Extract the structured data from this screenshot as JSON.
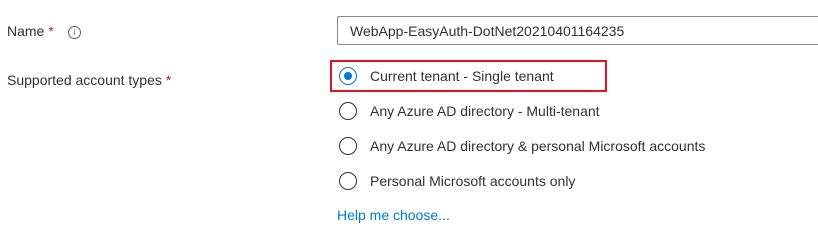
{
  "name_field": {
    "label": "Name",
    "required_marker": "*",
    "info_icon": "info-icon",
    "info_glyph": "i",
    "value": "WebApp-EasyAuth-DotNet20210401164235"
  },
  "account_types": {
    "label": "Supported account types",
    "required_marker": "*",
    "options": [
      {
        "label": "Current tenant - Single tenant",
        "selected": true
      },
      {
        "label": "Any Azure AD directory - Multi-tenant",
        "selected": false
      },
      {
        "label": "Any Azure AD directory & personal Microsoft accounts",
        "selected": false
      },
      {
        "label": "Personal Microsoft accounts only",
        "selected": false
      }
    ],
    "help_link": "Help me choose..."
  },
  "colors": {
    "accent": "#0078d4",
    "required": "#a4262c",
    "highlight": "#e81123",
    "text": "#323130"
  }
}
